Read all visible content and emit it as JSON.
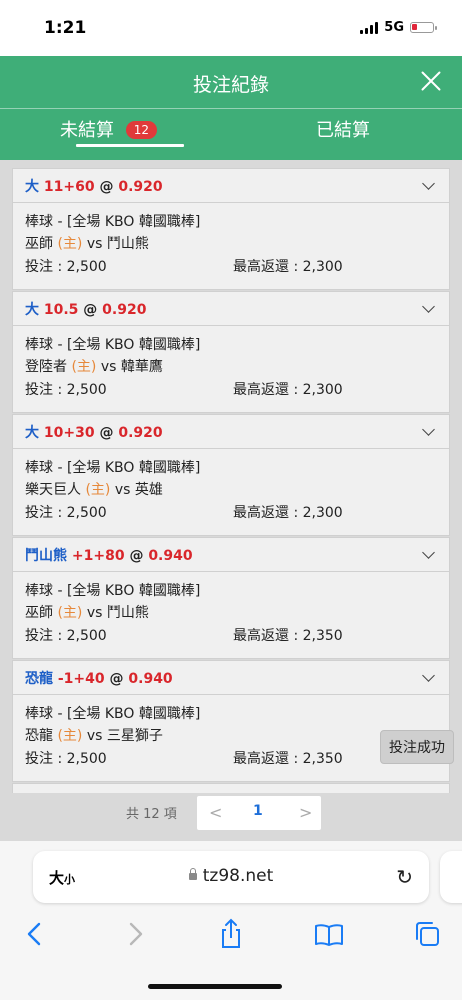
{
  "status_bar": {
    "time": "1:21",
    "network": "5G"
  },
  "header": {
    "title": "投注紀錄",
    "tabs": [
      {
        "label": "未結算",
        "badge": "12"
      },
      {
        "label": "已結算"
      }
    ]
  },
  "bets": [
    {
      "selection": "大",
      "handicap": "11+60",
      "at": "@",
      "odds": "0.920",
      "league": "棒球 - [全場 KBO 韓國職棒]",
      "home_team": "巫師",
      "home_mark": "(主)",
      "vs": "vs",
      "away_team": "鬥山熊",
      "stake": "投注 : 2,500",
      "max_return": "最高返還 : 2,300"
    },
    {
      "selection": "大",
      "handicap": "10.5",
      "at": "@",
      "odds": "0.920",
      "league": "棒球 - [全場 KBO 韓國職棒]",
      "home_team": "登陸者",
      "home_mark": "(主)",
      "vs": "vs",
      "away_team": "韓華鷹",
      "stake": "投注 : 2,500",
      "max_return": "最高返還 : 2,300"
    },
    {
      "selection": "大",
      "handicap": "10+30",
      "at": "@",
      "odds": "0.920",
      "league": "棒球 - [全場 KBO 韓國職棒]",
      "home_team": "樂天巨人",
      "home_mark": "(主)",
      "vs": "vs",
      "away_team": "英雄",
      "stake": "投注 : 2,500",
      "max_return": "最高返還 : 2,300"
    },
    {
      "selection": "鬥山熊",
      "handicap": "+1+80",
      "at": "@",
      "odds": "0.940",
      "league": "棒球 - [全場 KBO 韓國職棒]",
      "home_team": "巫師",
      "home_mark": "(主)",
      "vs": "vs",
      "away_team": "鬥山熊",
      "stake": "投注 : 2,500",
      "max_return": "最高返還 : 2,350"
    },
    {
      "selection": "恐龍",
      "handicap": "-1+40",
      "at": "@",
      "odds": "0.940",
      "league": "棒球 - [全場 KBO 韓國職棒]",
      "home_team": "恐龍",
      "home_mark": "(主)",
      "vs": "vs",
      "away_team": "三星獅子",
      "stake": "投注 : 2,500",
      "max_return": "最高返還 : 2,350"
    }
  ],
  "toast": "投注成功",
  "pagination": {
    "total": "共 12 項",
    "prev": "<",
    "current": "1",
    "next": ">"
  },
  "browser": {
    "text_size_big": "大",
    "text_size_small": "小",
    "url": "tz98.net"
  },
  "colors": {
    "header_green": "#3fae78",
    "odds_red": "#d9262b",
    "selection_blue": "#1e5fc7",
    "home_orange": "#e6883a",
    "badge_red": "#e03a3a"
  }
}
